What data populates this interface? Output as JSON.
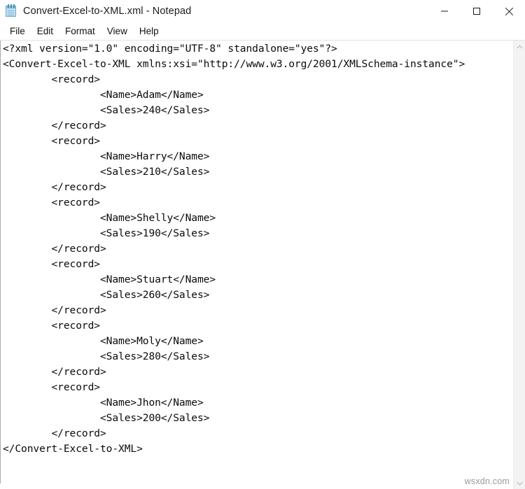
{
  "window": {
    "title": "Convert-Excel-to-XML.xml - Notepad",
    "icon": "notepad-icon",
    "controls": [
      {
        "name": "minimize-button",
        "glyph": "minimize-icon",
        "label": "Minimize"
      },
      {
        "name": "maximize-button",
        "glyph": "maximize-icon",
        "label": "Maximize"
      },
      {
        "name": "close-button",
        "glyph": "close-icon",
        "label": "Close"
      }
    ]
  },
  "menu": {
    "items": [
      {
        "label": "File"
      },
      {
        "label": "Edit"
      },
      {
        "label": "Format"
      },
      {
        "label": "View"
      },
      {
        "label": "Help"
      }
    ]
  },
  "editor": {
    "lines": [
      "<?xml version=\"1.0\" encoding=\"UTF-8\" standalone=\"yes\"?>",
      "<Convert-Excel-to-XML xmlns:xsi=\"http://www.w3.org/2001/XMLSchema-instance\">",
      "        <record>",
      "                <Name>Adam</Name>",
      "                <Sales>240</Sales>",
      "        </record>",
      "        <record>",
      "                <Name>Harry</Name>",
      "                <Sales>210</Sales>",
      "        </record>",
      "        <record>",
      "                <Name>Shelly</Name>",
      "                <Sales>190</Sales>",
      "        </record>",
      "        <record>",
      "                <Name>Stuart</Name>",
      "                <Sales>260</Sales>",
      "        </record>",
      "        <record>",
      "                <Name>Moly</Name>",
      "                <Sales>280</Sales>",
      "        </record>",
      "        <record>",
      "                <Name>Jhon</Name>",
      "                <Sales>200</Sales>",
      "        </record>",
      "</Convert-Excel-to-XML>"
    ],
    "records": [
      {
        "name": "Adam",
        "sales": "240"
      },
      {
        "name": "Harry",
        "sales": "210"
      },
      {
        "name": "Shelly",
        "sales": "190"
      },
      {
        "name": "Stuart",
        "sales": "260"
      },
      {
        "name": "Moly",
        "sales": "280"
      },
      {
        "name": "Jhon",
        "sales": "200"
      }
    ],
    "root_element": "Convert-Excel-to-XML",
    "xml_declaration": {
      "version": "1.0",
      "encoding": "UTF-8",
      "standalone": "yes"
    },
    "namespace": "http://www.w3.org/2001/XMLSchema-instance"
  },
  "scrollbar": {
    "up_icon": "chevron-up-icon",
    "down_icon": "chevron-down-icon"
  },
  "watermark": {
    "text": "wsxdn.com"
  },
  "colors": {
    "window_background": "#ffffff",
    "text": "#0b0b0b",
    "title_text": "#1c1c1c",
    "scrollbar_track": "#f3f3f3",
    "scrollbar_arrow": "#c4c4c4",
    "watermark": "#9a9a9a",
    "editor_border": "#aaaaaa",
    "icon_blue": "#bfe0f2"
  }
}
